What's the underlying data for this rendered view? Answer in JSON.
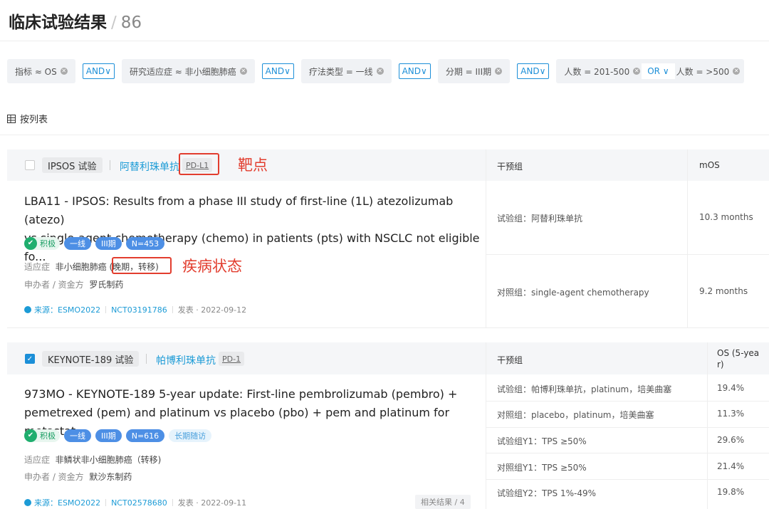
{
  "page": {
    "title": "临床试验结果",
    "separator": "/",
    "count": "86"
  },
  "filters": {
    "chip1": "指标 ≈ OS",
    "and1": "AND",
    "chip2": "研究适应症 ≈ 非小细胞肺癌",
    "and2": "AND",
    "chip3": "疗法类型 = 一线",
    "and3": "AND",
    "chip4": "分期 = III期",
    "and4": "AND",
    "chip5": "人数 = 201-500",
    "or1": "OR",
    "chip6": "人数 = >500"
  },
  "view": {
    "label": "按列表"
  },
  "annotations": {
    "target": "靶点",
    "disease_state": "疾病状态"
  },
  "cards": [
    {
      "checked": false,
      "trial": "IPSOS 试验",
      "drug": "阿替利珠单抗",
      "target": "PD-L1",
      "headline_line1": "LBA11 - IPSOS: Results from a phase III study of first-line (1L) atezolizumab (atezo)",
      "headline_line2": "vs single-agent chemotherapy (chemo) in patients (pts) with NSCLC not eligible fo...",
      "tag_positive": "积极",
      "tag_line": "一线",
      "tag_phase": "III期",
      "tag_n": "N=453",
      "indication_label": "适应症",
      "indication": "非小细胞肺癌",
      "indication_state": "(晚期，转移)",
      "sponsor_label": "申办者 / 资金方",
      "sponsor": "罗氏制药",
      "source": "来源：ESMO2022",
      "nct": "NCT03191786",
      "published_label": "发表 · 2022-09-12",
      "col_group": "干预组",
      "col_metric": "mOS",
      "rows": [
        {
          "group": "试验组：阿替利珠单抗",
          "value": "10.3 months"
        },
        {
          "group": "对照组：single-agent chemotherapy",
          "value": "9.2 months"
        }
      ]
    },
    {
      "checked": true,
      "trial": "KEYNOTE-189 试验",
      "drug": "帕博利珠单抗",
      "target": "PD-1",
      "headline_line1": "973MO - KEYNOTE-189 5-year update: First-line pembrolizumab (pembro) +",
      "headline_line2": "pemetrexed (pem) and platinum vs placebo (pbo) + pem and platinum for metastat...",
      "tag_positive": "积极",
      "tag_line": "一线",
      "tag_phase": "III期",
      "tag_n": "N=616",
      "tag_followup": "长期随访",
      "indication_label": "适应症",
      "indication": "非鳞状非小细胞肺癌（转移)",
      "sponsor_label": "申办者 / 资金方",
      "sponsor": "默沙东制药",
      "source": "来源：ESMO2022",
      "nct": "NCT02578680",
      "published_label": "发表 · 2022-09-11",
      "related": "相关结果 / 4",
      "col_group": "干预组",
      "col_metric_line1": "OS (5-yea",
      "col_metric_line2": "r)",
      "rows": [
        {
          "group": "试验组：帕博利珠单抗，platinum，培美曲塞",
          "value": "19.4%"
        },
        {
          "group": "对照组：placebo，platinum，培美曲塞",
          "value": "11.3%"
        },
        {
          "group": "试验组Y1：TPS ≥50%",
          "value": "29.6%"
        },
        {
          "group": "对照组Y1：TPS ≥50%",
          "value": "21.4%"
        },
        {
          "group": "试验组Y2：TPS 1%-49%",
          "value": "19.8%"
        }
      ]
    }
  ]
}
